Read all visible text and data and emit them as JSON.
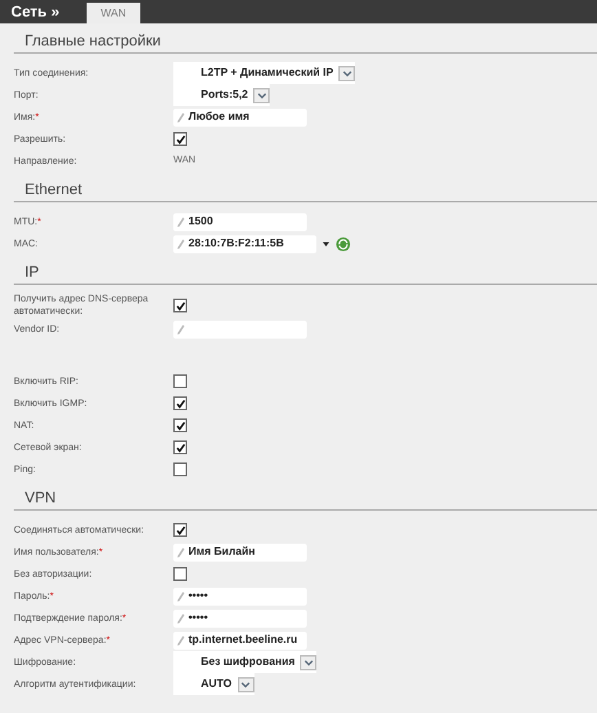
{
  "header": {
    "title": "Сеть »",
    "tabs": [
      {
        "label": "WAN",
        "selected": true
      }
    ]
  },
  "sections": [
    {
      "title": "Главные настройки",
      "rows": [
        {
          "label": "Тип соединения:",
          "kind": "select",
          "value": "L2TP + Динамический IP"
        },
        {
          "label": "Порт:",
          "kind": "select",
          "value": "Ports:5,2"
        },
        {
          "label": "Имя:",
          "mark": "*",
          "kind": "text",
          "value": "Любое имя"
        },
        {
          "label": "Разрешить:",
          "kind": "checkbox",
          "checked": true
        },
        {
          "label": "Направление:",
          "kind": "static",
          "value": "WAN"
        }
      ]
    },
    {
      "title": "Ethernet",
      "rows": [
        {
          "label": "MTU:",
          "mark": "*",
          "kind": "text",
          "value": "1500"
        },
        {
          "label": "MAC:",
          "kind": "mac",
          "value": "28:10:7B:F2:11:5B"
        }
      ]
    },
    {
      "title": "IP",
      "rows": [
        {
          "label": "Получить адрес DNS-сервера автоматически:",
          "kind": "checkbox",
          "checked": true
        },
        {
          "label": "Vendor ID:",
          "kind": "text"
        }
      ]
    },
    {
      "rows": [
        {
          "label": "Включить RIP:",
          "kind": "checkbox",
          "checked": false
        },
        {
          "label": "Включить IGMP:",
          "kind": "checkbox",
          "checked": true
        },
        {
          "label": "NAT:",
          "kind": "checkbox",
          "checked": true
        },
        {
          "label": "Сетевой экран:",
          "kind": "checkbox",
          "checked": true
        },
        {
          "label": "Ping:",
          "kind": "checkbox",
          "checked": false
        }
      ]
    },
    {
      "title": "VPN",
      "rows": [
        {
          "label": "Соединяться автоматически:",
          "kind": "checkbox",
          "checked": true
        },
        {
          "label": "Имя пользователя:",
          "mark": "*",
          "kind": "text",
          "value": "Имя Билайн"
        },
        {
          "label": "Без авторизации:",
          "kind": "checkbox",
          "checked": false
        },
        {
          "label": "Пароль:",
          "mark": "*",
          "kind": "text",
          "value": "•••••"
        },
        {
          "label": "Подтверждение пароля:",
          "mark": "*",
          "kind": "text",
          "value": "•••••"
        },
        {
          "label": "Адрес VPN-сервера:",
          "mark": "*",
          "kind": "text",
          "value": "tp.internet.beeline.ru"
        },
        {
          "label": "Шифрование:",
          "kind": "select",
          "value": "Без шифрования"
        },
        {
          "label": "Алгоритм аутентификации:",
          "kind": "select",
          "value": "AUTO"
        }
      ]
    }
  ]
}
